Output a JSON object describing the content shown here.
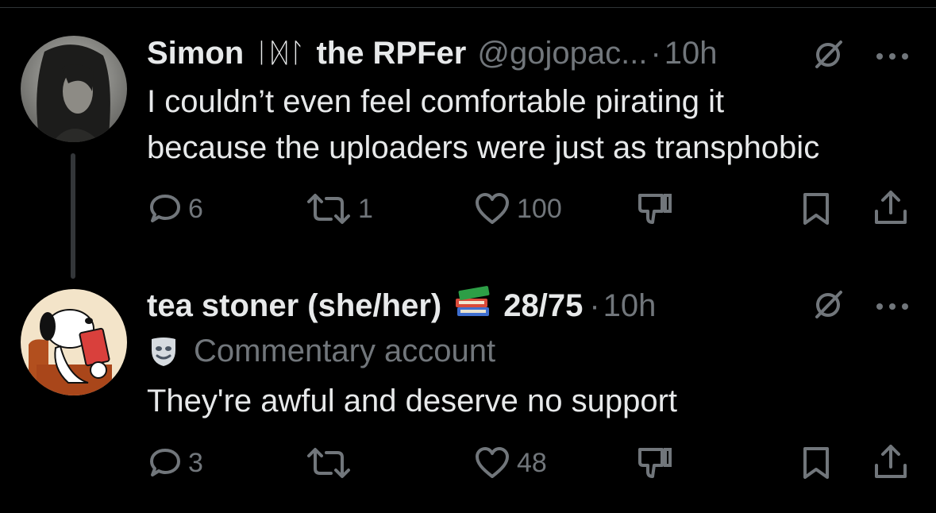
{
  "tweets": [
    {
      "display_name": "Simon",
      "runes": "ᛁᛞᛚ",
      "name_suffix": "the RPFer",
      "handle": "@gojopac...",
      "separator": "·",
      "time": "10h",
      "text_lines": [
        "I couldn’t even feel comfortable pirating it",
        "because the uploaders were just as transphobic"
      ],
      "reply_count": "6",
      "retweet_count": "1",
      "like_count": "100"
    },
    {
      "display_name": "tea stoner (she/her)",
      "name_suffix": "28/75",
      "separator": "·",
      "time": "10h",
      "label": "Commentary account",
      "text_lines": [
        "They're awful and deserve no support"
      ],
      "reply_count": "3",
      "retweet_count": "",
      "like_count": "48"
    }
  ],
  "icons": {
    "reply": "reply-icon",
    "retweet": "retweet-icon",
    "like": "heart-icon",
    "dislike": "thumbs-down-icon",
    "bookmark": "bookmark-icon",
    "share": "share-icon",
    "grok": "grok-icon",
    "more": "more-icon",
    "books": "books-emoji",
    "mask": "performing-arts-icon"
  },
  "colors": {
    "background": "#000000",
    "text": "#e7e9ea",
    "muted": "#71767b",
    "thread_line": "#333639"
  }
}
